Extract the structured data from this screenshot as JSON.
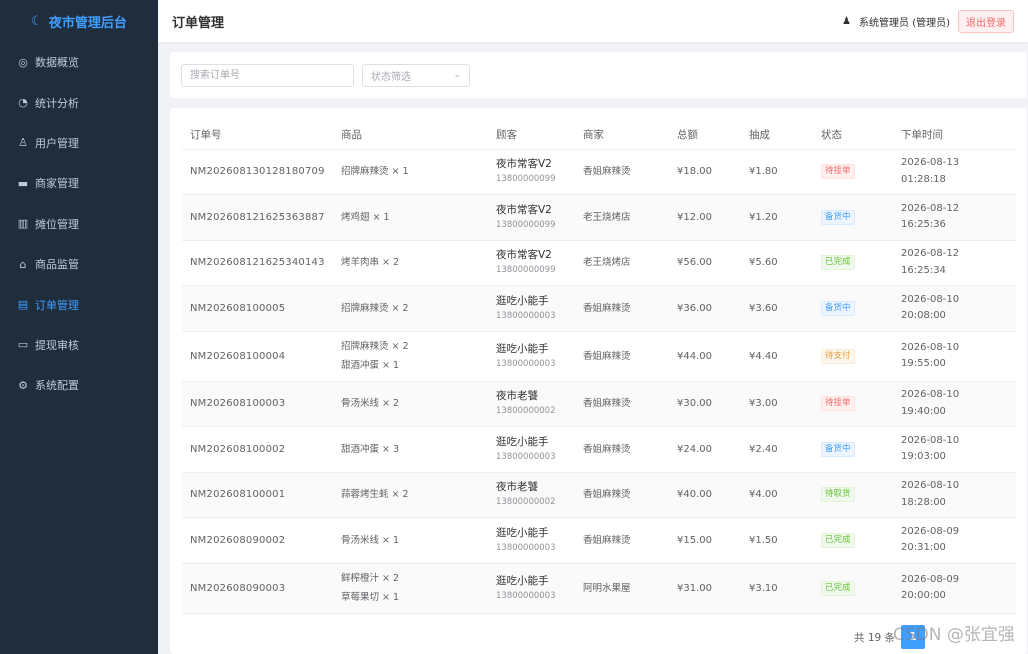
{
  "app": {
    "title": "夜市管理后台"
  },
  "sidebar": {
    "items": [
      {
        "label": "数据概览",
        "icon": "gauge-icon",
        "glyph": "◎",
        "active": false
      },
      {
        "label": "统计分析",
        "icon": "pie-chart-icon",
        "glyph": "◔",
        "active": false
      },
      {
        "label": "用户管理",
        "icon": "user-icon",
        "glyph": "♙",
        "active": false
      },
      {
        "label": "商家管理",
        "icon": "shop-icon",
        "glyph": "▬",
        "active": false
      },
      {
        "label": "摊位管理",
        "icon": "stall-icon",
        "glyph": "▥",
        "active": false
      },
      {
        "label": "商品监管",
        "icon": "bag-icon",
        "glyph": "⌂",
        "active": false
      },
      {
        "label": "订单管理",
        "icon": "order-icon",
        "glyph": "▤",
        "active": true
      },
      {
        "label": "提现审核",
        "icon": "folder-icon",
        "glyph": "▭",
        "active": false
      },
      {
        "label": "系统配置",
        "icon": "gear-icon",
        "glyph": "⚙",
        "active": false
      }
    ]
  },
  "header": {
    "title": "订单管理",
    "user": "系统管理员 (管理员)",
    "logout": "退出登录"
  },
  "filters": {
    "search_placeholder": "搜索订单号",
    "status_placeholder": "状态筛选"
  },
  "table": {
    "columns": [
      "订单号",
      "商品",
      "顾客",
      "商家",
      "总额",
      "抽成",
      "状态",
      "下单时间"
    ],
    "rows": [
      {
        "order_no": "NM202608130128180709",
        "goods": [
          "招牌麻辣烫 × 1"
        ],
        "customer": "夜市常客V2",
        "phone": "13800000099",
        "merchant": "香姐麻辣烫",
        "total": "¥18.00",
        "commission": "¥1.80",
        "status": "待接单",
        "status_type": "danger",
        "date": "2026-08-13",
        "time": "01:28:18"
      },
      {
        "order_no": "NM202608121625363887",
        "goods": [
          "烤鸡翅 × 1"
        ],
        "customer": "夜市常客V2",
        "phone": "13800000099",
        "merchant": "老王烧烤店",
        "total": "¥12.00",
        "commission": "¥1.20",
        "status": "备货中",
        "status_type": "primary",
        "date": "2026-08-12",
        "time": "16:25:36"
      },
      {
        "order_no": "NM202608121625340143",
        "goods": [
          "烤羊肉串 × 2"
        ],
        "customer": "夜市常客V2",
        "phone": "13800000099",
        "merchant": "老王烧烤店",
        "total": "¥56.00",
        "commission": "¥5.60",
        "status": "已完成",
        "status_type": "success",
        "date": "2026-08-12",
        "time": "16:25:34"
      },
      {
        "order_no": "NM202608100005",
        "goods": [
          "招牌麻辣烫 × 2"
        ],
        "customer": "逛吃小能手",
        "phone": "13800000003",
        "merchant": "香姐麻辣烫",
        "total": "¥36.00",
        "commission": "¥3.60",
        "status": "备货中",
        "status_type": "primary",
        "date": "2026-08-10",
        "time": "20:08:00"
      },
      {
        "order_no": "NM202608100004",
        "goods": [
          "招牌麻辣烫 × 2",
          "甜酒冲蛋 × 1"
        ],
        "customer": "逛吃小能手",
        "phone": "13800000003",
        "merchant": "香姐麻辣烫",
        "total": "¥44.00",
        "commission": "¥4.40",
        "status": "待支付",
        "status_type": "warning",
        "date": "2026-08-10",
        "time": "19:55:00"
      },
      {
        "order_no": "NM202608100003",
        "goods": [
          "骨汤米线 × 2"
        ],
        "customer": "夜市老饕",
        "phone": "13800000002",
        "merchant": "香姐麻辣烫",
        "total": "¥30.00",
        "commission": "¥3.00",
        "status": "待接单",
        "status_type": "danger",
        "date": "2026-08-10",
        "time": "19:40:00"
      },
      {
        "order_no": "NM202608100002",
        "goods": [
          "甜酒冲蛋 × 3"
        ],
        "customer": "逛吃小能手",
        "phone": "13800000003",
        "merchant": "香姐麻辣烫",
        "total": "¥24.00",
        "commission": "¥2.40",
        "status": "备货中",
        "status_type": "primary",
        "date": "2026-08-10",
        "time": "19:03:00"
      },
      {
        "order_no": "NM202608100001",
        "goods": [
          "蒜蓉烤生蚝 × 2"
        ],
        "customer": "夜市老饕",
        "phone": "13800000002",
        "merchant": "香姐麻辣烫",
        "total": "¥40.00",
        "commission": "¥4.00",
        "status": "待取货",
        "status_type": "success",
        "date": "2026-08-10",
        "time": "18:28:00"
      },
      {
        "order_no": "NM202608090002",
        "goods": [
          "骨汤米线 × 1"
        ],
        "customer": "逛吃小能手",
        "phone": "13800000003",
        "merchant": "香姐麻辣烫",
        "total": "¥15.00",
        "commission": "¥1.50",
        "status": "已完成",
        "status_type": "success",
        "date": "2026-08-09",
        "time": "20:31:00"
      },
      {
        "order_no": "NM202608090003",
        "goods": [
          "鲜榨橙汁 × 2",
          "草莓果切 × 1"
        ],
        "customer": "逛吃小能手",
        "phone": "13800000003",
        "merchant": "阿明水果屋",
        "total": "¥31.00",
        "commission": "¥3.10",
        "status": "已完成",
        "status_type": "success",
        "date": "2026-08-09",
        "time": "20:00:00"
      }
    ]
  },
  "pagination": {
    "total_text": "共 19 条",
    "current_page": "1"
  },
  "watermark": "CSDN @张宜强"
}
